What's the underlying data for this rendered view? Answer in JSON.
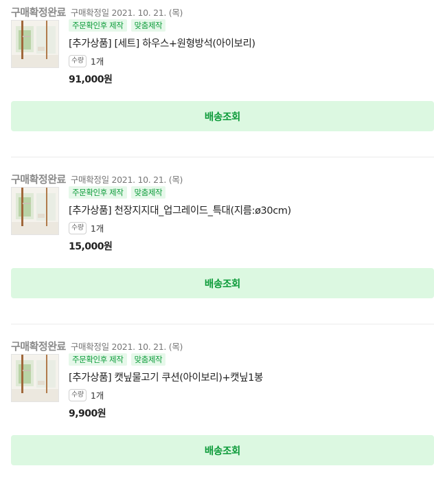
{
  "orders": [
    {
      "status": "구매확정완료",
      "date": "구매확정일 2021. 10. 21. (목)",
      "badges": [
        "주문확인후 제작",
        "맞춤제작"
      ],
      "product_name": "[추가상품] [세트] 하우스+원형방석(아이보리)",
      "qty_label": "수량",
      "qty_value": "1개",
      "price": "91,000원",
      "button_label": "배송조회",
      "thumbnail_icon": "product-photo"
    },
    {
      "status": "구매확정완료",
      "date": "구매확정일 2021. 10. 21. (목)",
      "badges": [
        "주문확인후 제작",
        "맞춤제작"
      ],
      "product_name": "[추가상품] 천장지지대_업그레이드_특대(지름:ø30cm)",
      "qty_label": "수량",
      "qty_value": "1개",
      "price": "15,000원",
      "button_label": "배송조회",
      "thumbnail_icon": "product-photo"
    },
    {
      "status": "구매확정완료",
      "date": "구매확정일 2021. 10. 21. (목)",
      "badges": [
        "주문확인후 제작",
        "맞춤제작"
      ],
      "product_name": "[추가상품] 캣닢물고기 쿠션(아이보리)+캣닢1봉",
      "qty_label": "수량",
      "qty_value": "1개",
      "price": "9,900원",
      "button_label": "배송조회",
      "thumbnail_icon": "product-photo"
    }
  ],
  "colors": {
    "accent_green": "#0b9a38",
    "button_bg": "#dcf8e1",
    "badge_bg": "#e6f8ea",
    "status_gray": "#8a8a8a"
  }
}
